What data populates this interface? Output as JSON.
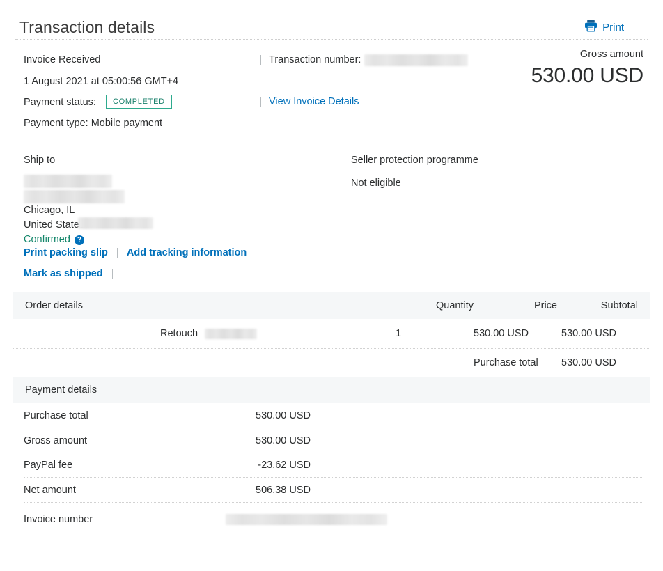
{
  "header": {
    "title": "Transaction details",
    "print_label": "Print",
    "print_icon": "printer-icon"
  },
  "summary": {
    "status_line": "Invoice Received",
    "datetime": "1 August 2021  at 05:00:56 GMT+4",
    "payment_status_label": "Payment status:",
    "payment_status_badge": "COMPLETED",
    "payment_type": "Payment type: Mobile payment",
    "transaction_number_label": "Transaction number:",
    "transaction_number_value": "",
    "view_invoice_link": "View Invoice Details",
    "gross_amount_label": "Gross amount",
    "gross_amount_value": "530.00 USD"
  },
  "ship_to": {
    "heading": "Ship to",
    "address_line_city": "Chicago, IL",
    "address_line_country": "United States",
    "confirmed_label": "Confirmed",
    "help_icon": "question-mark-icon",
    "actions": [
      "Print packing slip",
      "Add tracking information",
      "Mark as shipped"
    ]
  },
  "seller_protection": {
    "heading": "Seller protection programme",
    "value": "Not eligible"
  },
  "order_details": {
    "section_title": "Order details",
    "columns": {
      "quantity": "Quantity",
      "price": "Price",
      "subtotal": "Subtotal"
    },
    "items": [
      {
        "description": "Retouch",
        "quantity": "1",
        "price": "530.00 USD",
        "subtotal": "530.00 USD"
      }
    ],
    "purchase_total_label": "Purchase total",
    "purchase_total_value": "530.00 USD"
  },
  "payment_details": {
    "section_title": "Payment details",
    "rows": [
      {
        "name": "Purchase total",
        "value": "530.00 USD"
      },
      {
        "name": "Gross amount",
        "value": "530.00 USD"
      },
      {
        "name": "PayPal fee",
        "value": "-23.62 USD"
      },
      {
        "name": "Net amount",
        "value": "506.38 USD"
      }
    ],
    "invoice_number_label": "Invoice number",
    "invoice_number_value": ""
  },
  "colors": {
    "link_blue": "#0070ba",
    "badge_border": "#2eaa8e",
    "badge_text": "#19806b",
    "confirmed_green": "#13866a",
    "section_bg": "#f5f7f8",
    "text": "#2c2e2f"
  }
}
